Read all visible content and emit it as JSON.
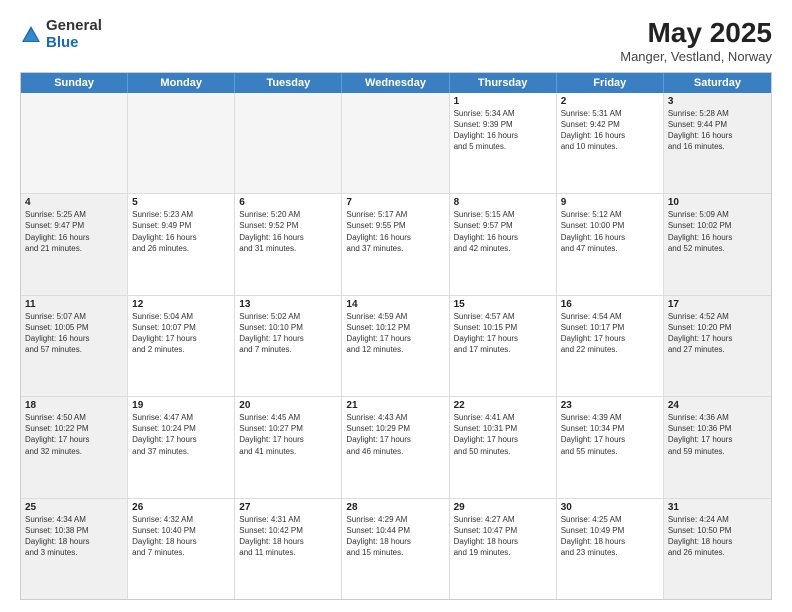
{
  "logo": {
    "general": "General",
    "blue": "Blue"
  },
  "title": "May 2025",
  "subtitle": "Manger, Vestland, Norway",
  "headers": [
    "Sunday",
    "Monday",
    "Tuesday",
    "Wednesday",
    "Thursday",
    "Friday",
    "Saturday"
  ],
  "rows": [
    [
      {
        "day": "",
        "text": "",
        "empty": true
      },
      {
        "day": "",
        "text": "",
        "empty": true
      },
      {
        "day": "",
        "text": "",
        "empty": true
      },
      {
        "day": "",
        "text": "",
        "empty": true
      },
      {
        "day": "1",
        "text": "Sunrise: 5:34 AM\nSunset: 9:39 PM\nDaylight: 16 hours\nand 5 minutes.",
        "empty": false
      },
      {
        "day": "2",
        "text": "Sunrise: 5:31 AM\nSunset: 9:42 PM\nDaylight: 16 hours\nand 10 minutes.",
        "empty": false
      },
      {
        "day": "3",
        "text": "Sunrise: 5:28 AM\nSunset: 9:44 PM\nDaylight: 16 hours\nand 16 minutes.",
        "empty": false
      }
    ],
    [
      {
        "day": "4",
        "text": "Sunrise: 5:25 AM\nSunset: 9:47 PM\nDaylight: 16 hours\nand 21 minutes.",
        "empty": false
      },
      {
        "day": "5",
        "text": "Sunrise: 5:23 AM\nSunset: 9:49 PM\nDaylight: 16 hours\nand 26 minutes.",
        "empty": false
      },
      {
        "day": "6",
        "text": "Sunrise: 5:20 AM\nSunset: 9:52 PM\nDaylight: 16 hours\nand 31 minutes.",
        "empty": false
      },
      {
        "day": "7",
        "text": "Sunrise: 5:17 AM\nSunset: 9:55 PM\nDaylight: 16 hours\nand 37 minutes.",
        "empty": false
      },
      {
        "day": "8",
        "text": "Sunrise: 5:15 AM\nSunset: 9:57 PM\nDaylight: 16 hours\nand 42 minutes.",
        "empty": false
      },
      {
        "day": "9",
        "text": "Sunrise: 5:12 AM\nSunset: 10:00 PM\nDaylight: 16 hours\nand 47 minutes.",
        "empty": false
      },
      {
        "day": "10",
        "text": "Sunrise: 5:09 AM\nSunset: 10:02 PM\nDaylight: 16 hours\nand 52 minutes.",
        "empty": false
      }
    ],
    [
      {
        "day": "11",
        "text": "Sunrise: 5:07 AM\nSunset: 10:05 PM\nDaylight: 16 hours\nand 57 minutes.",
        "empty": false
      },
      {
        "day": "12",
        "text": "Sunrise: 5:04 AM\nSunset: 10:07 PM\nDaylight: 17 hours\nand 2 minutes.",
        "empty": false
      },
      {
        "day": "13",
        "text": "Sunrise: 5:02 AM\nSunset: 10:10 PM\nDaylight: 17 hours\nand 7 minutes.",
        "empty": false
      },
      {
        "day": "14",
        "text": "Sunrise: 4:59 AM\nSunset: 10:12 PM\nDaylight: 17 hours\nand 12 minutes.",
        "empty": false
      },
      {
        "day": "15",
        "text": "Sunrise: 4:57 AM\nSunset: 10:15 PM\nDaylight: 17 hours\nand 17 minutes.",
        "empty": false
      },
      {
        "day": "16",
        "text": "Sunrise: 4:54 AM\nSunset: 10:17 PM\nDaylight: 17 hours\nand 22 minutes.",
        "empty": false
      },
      {
        "day": "17",
        "text": "Sunrise: 4:52 AM\nSunset: 10:20 PM\nDaylight: 17 hours\nand 27 minutes.",
        "empty": false
      }
    ],
    [
      {
        "day": "18",
        "text": "Sunrise: 4:50 AM\nSunset: 10:22 PM\nDaylight: 17 hours\nand 32 minutes.",
        "empty": false
      },
      {
        "day": "19",
        "text": "Sunrise: 4:47 AM\nSunset: 10:24 PM\nDaylight: 17 hours\nand 37 minutes.",
        "empty": false
      },
      {
        "day": "20",
        "text": "Sunrise: 4:45 AM\nSunset: 10:27 PM\nDaylight: 17 hours\nand 41 minutes.",
        "empty": false
      },
      {
        "day": "21",
        "text": "Sunrise: 4:43 AM\nSunset: 10:29 PM\nDaylight: 17 hours\nand 46 minutes.",
        "empty": false
      },
      {
        "day": "22",
        "text": "Sunrise: 4:41 AM\nSunset: 10:31 PM\nDaylight: 17 hours\nand 50 minutes.",
        "empty": false
      },
      {
        "day": "23",
        "text": "Sunrise: 4:39 AM\nSunset: 10:34 PM\nDaylight: 17 hours\nand 55 minutes.",
        "empty": false
      },
      {
        "day": "24",
        "text": "Sunrise: 4:36 AM\nSunset: 10:36 PM\nDaylight: 17 hours\nand 59 minutes.",
        "empty": false
      }
    ],
    [
      {
        "day": "25",
        "text": "Sunrise: 4:34 AM\nSunset: 10:38 PM\nDaylight: 18 hours\nand 3 minutes.",
        "empty": false
      },
      {
        "day": "26",
        "text": "Sunrise: 4:32 AM\nSunset: 10:40 PM\nDaylight: 18 hours\nand 7 minutes.",
        "empty": false
      },
      {
        "day": "27",
        "text": "Sunrise: 4:31 AM\nSunset: 10:42 PM\nDaylight: 18 hours\nand 11 minutes.",
        "empty": false
      },
      {
        "day": "28",
        "text": "Sunrise: 4:29 AM\nSunset: 10:44 PM\nDaylight: 18 hours\nand 15 minutes.",
        "empty": false
      },
      {
        "day": "29",
        "text": "Sunrise: 4:27 AM\nSunset: 10:47 PM\nDaylight: 18 hours\nand 19 minutes.",
        "empty": false
      },
      {
        "day": "30",
        "text": "Sunrise: 4:25 AM\nSunset: 10:49 PM\nDaylight: 18 hours\nand 23 minutes.",
        "empty": false
      },
      {
        "day": "31",
        "text": "Sunrise: 4:24 AM\nSunset: 10:50 PM\nDaylight: 18 hours\nand 26 minutes.",
        "empty": false
      }
    ]
  ],
  "colors": {
    "header_bg": "#3a7fc1",
    "header_text": "#ffffff",
    "shaded_bg": "#f0f0f0"
  }
}
